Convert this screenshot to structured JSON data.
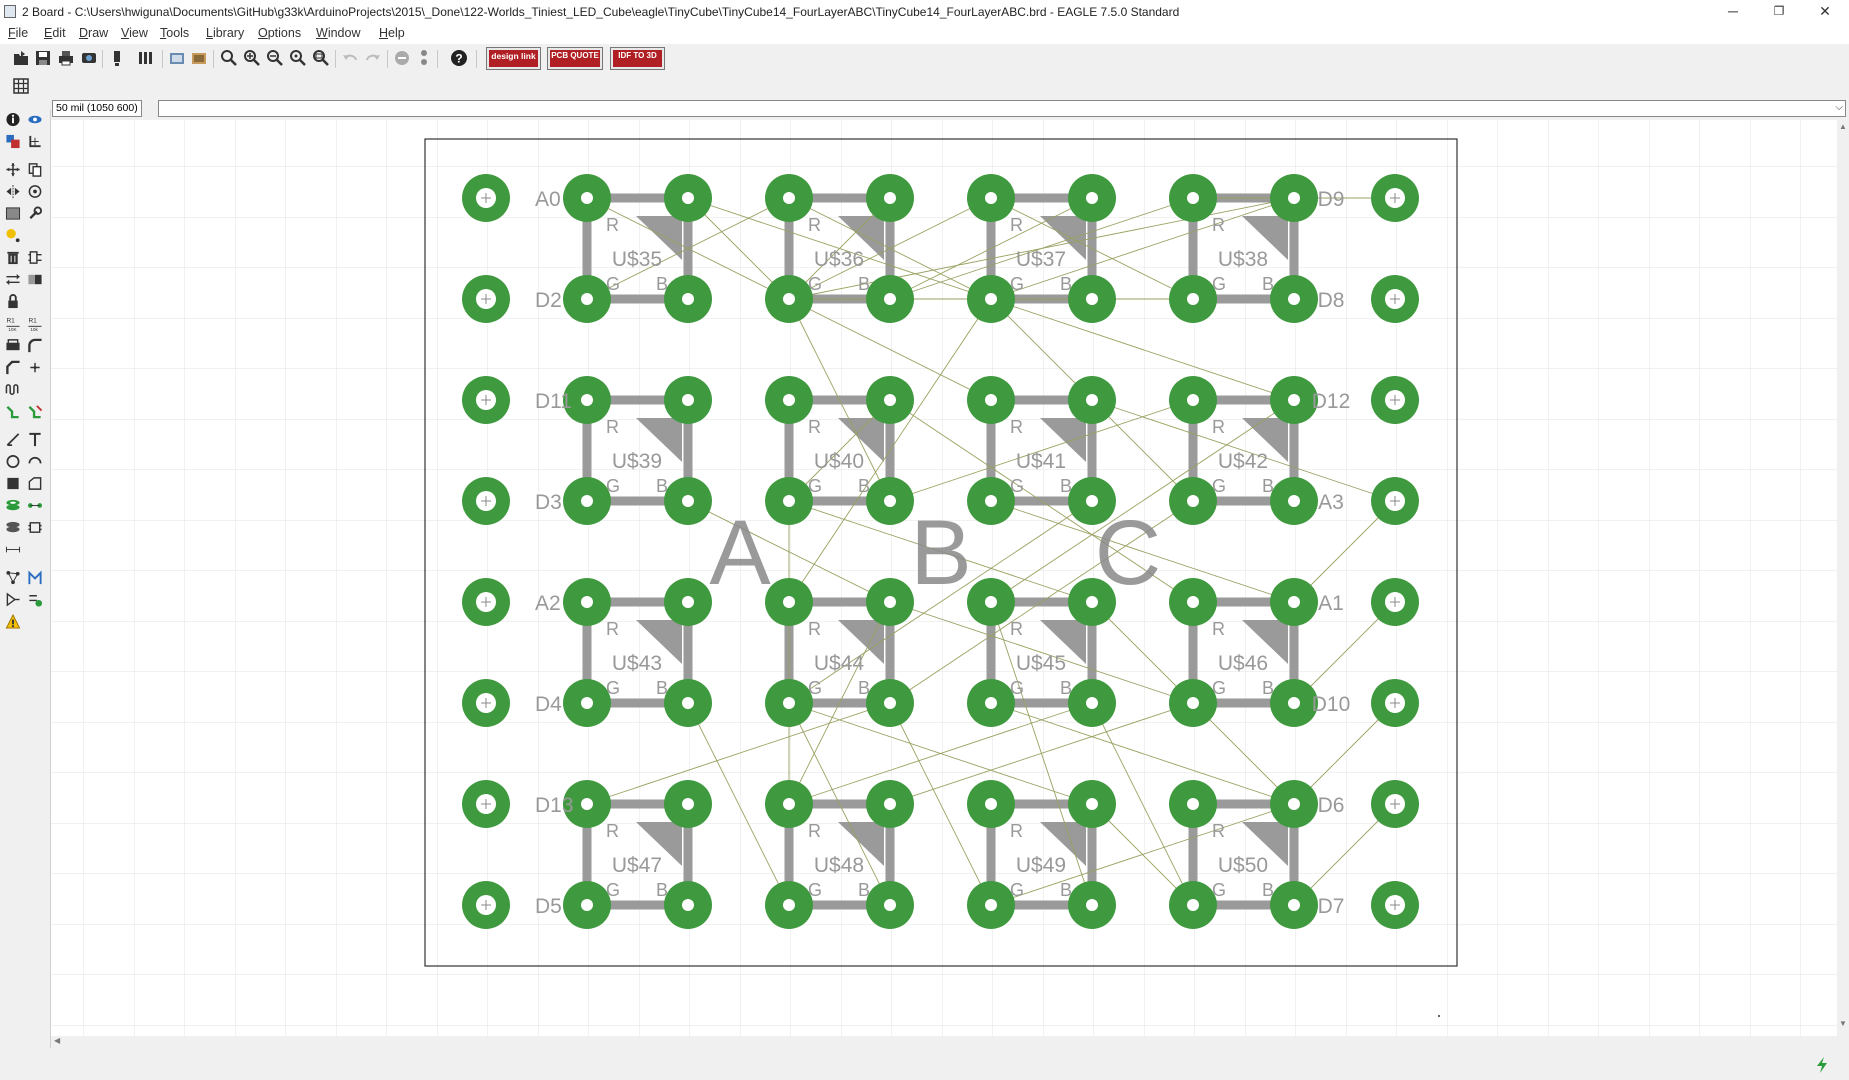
{
  "window": {
    "title": "2 Board - C:\\Users\\hwiguna\\Documents\\GitHub\\g33k\\ArduinoProjects\\2015\\_Done\\122-Worlds_Tiniest_LED_Cube\\eagle\\TinyCube\\TinyCube14_FourLayerABC\\TinyCube14_FourLayerABC.brd - EAGLE 7.5.0 Standard",
    "minimize": "─",
    "maximize": "❐",
    "close": "✕"
  },
  "menu": [
    {
      "label": "File",
      "u": "F",
      "rest": "ile"
    },
    {
      "label": "Edit",
      "u": "E",
      "rest": "dit"
    },
    {
      "label": "Draw",
      "u": "D",
      "rest": "raw"
    },
    {
      "label": "View",
      "u": "V",
      "rest": "iew"
    },
    {
      "label": "Tools",
      "u": "T",
      "rest": "ools"
    },
    {
      "label": "Library",
      "u": "L",
      "rest": "ibrary"
    },
    {
      "label": "Options",
      "u": "O",
      "rest": "ptions"
    },
    {
      "label": "Window",
      "u": "W",
      "rest": "indow"
    },
    {
      "label": "Help",
      "u": "H",
      "rest": "elp"
    }
  ],
  "toolbar": {
    "design_link": "design link",
    "pcb_quote": "PCB QUOTE",
    "idf_to_3d": "IDF TO 3D"
  },
  "command": {
    "grid_readout": "50 mil (1050 600)",
    "input_value": ""
  },
  "board": {
    "side_labels_left": [
      "A0",
      "D2",
      "D11",
      "D3",
      "A2",
      "D4",
      "D13",
      "D5"
    ],
    "side_labels_right": [
      "D9",
      "D8",
      "D12",
      "A3",
      "A1",
      "D10",
      "D6",
      "D7"
    ],
    "parts": [
      [
        "U$35",
        "U$36",
        "U$37",
        "U$38"
      ],
      [
        "U$39",
        "U$40",
        "U$41",
        "U$42"
      ],
      [
        "U$43",
        "U$44",
        "U$45",
        "U$46"
      ],
      [
        "U$47",
        "U$48",
        "U$49",
        "U$50"
      ]
    ],
    "pin_r": "R",
    "pin_g": "G",
    "pin_b": "B",
    "layer_text": [
      "A",
      "B",
      "C"
    ],
    "colors": {
      "pad": "#3f9a3f",
      "pad_hole": "#ffffff",
      "silk": "#9a9a9a",
      "airwire": "#9aa060",
      "outline": "#333333",
      "grid": "#e3e3e3"
    }
  }
}
